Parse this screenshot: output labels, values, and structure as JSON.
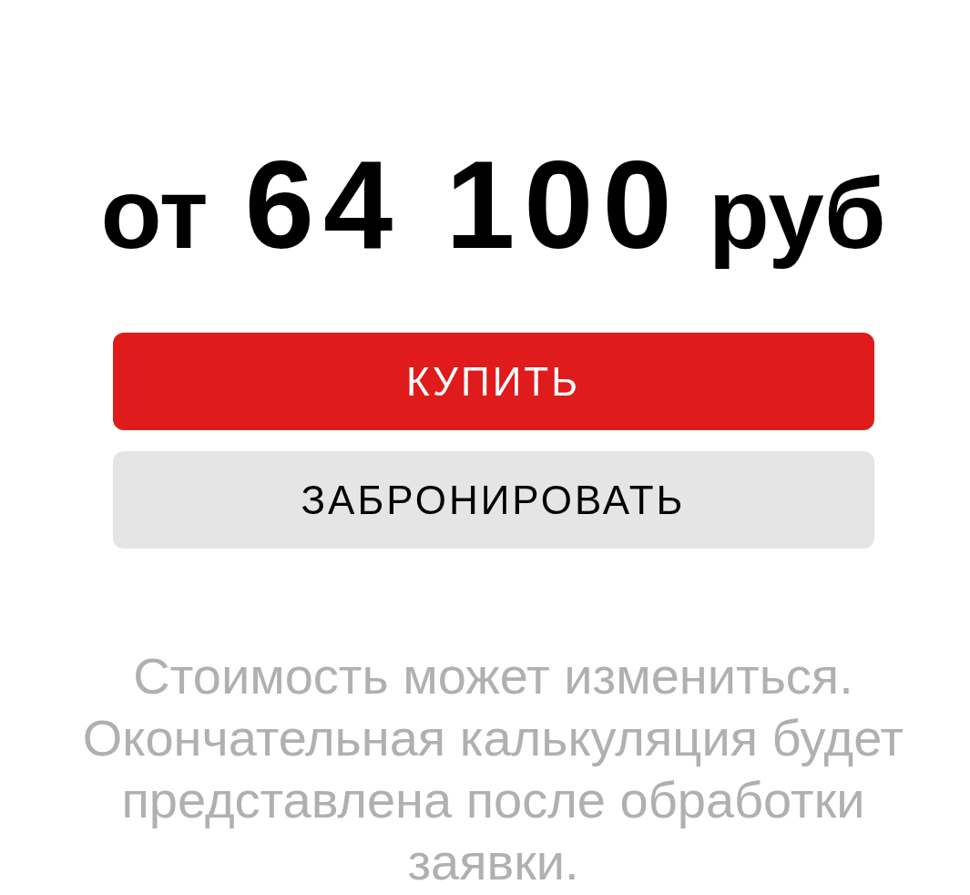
{
  "price": {
    "prefix": "от",
    "amount": "64 100",
    "currency": "руб"
  },
  "buttons": [
    {
      "label": "КУПИТЬ",
      "kind": "primary"
    },
    {
      "label": "ЗАБРОНИРОВАТЬ",
      "kind": "secondary"
    }
  ],
  "note": "Стоимость может измениться. Окончательная калькуляция будет представлена после обработки заявки."
}
